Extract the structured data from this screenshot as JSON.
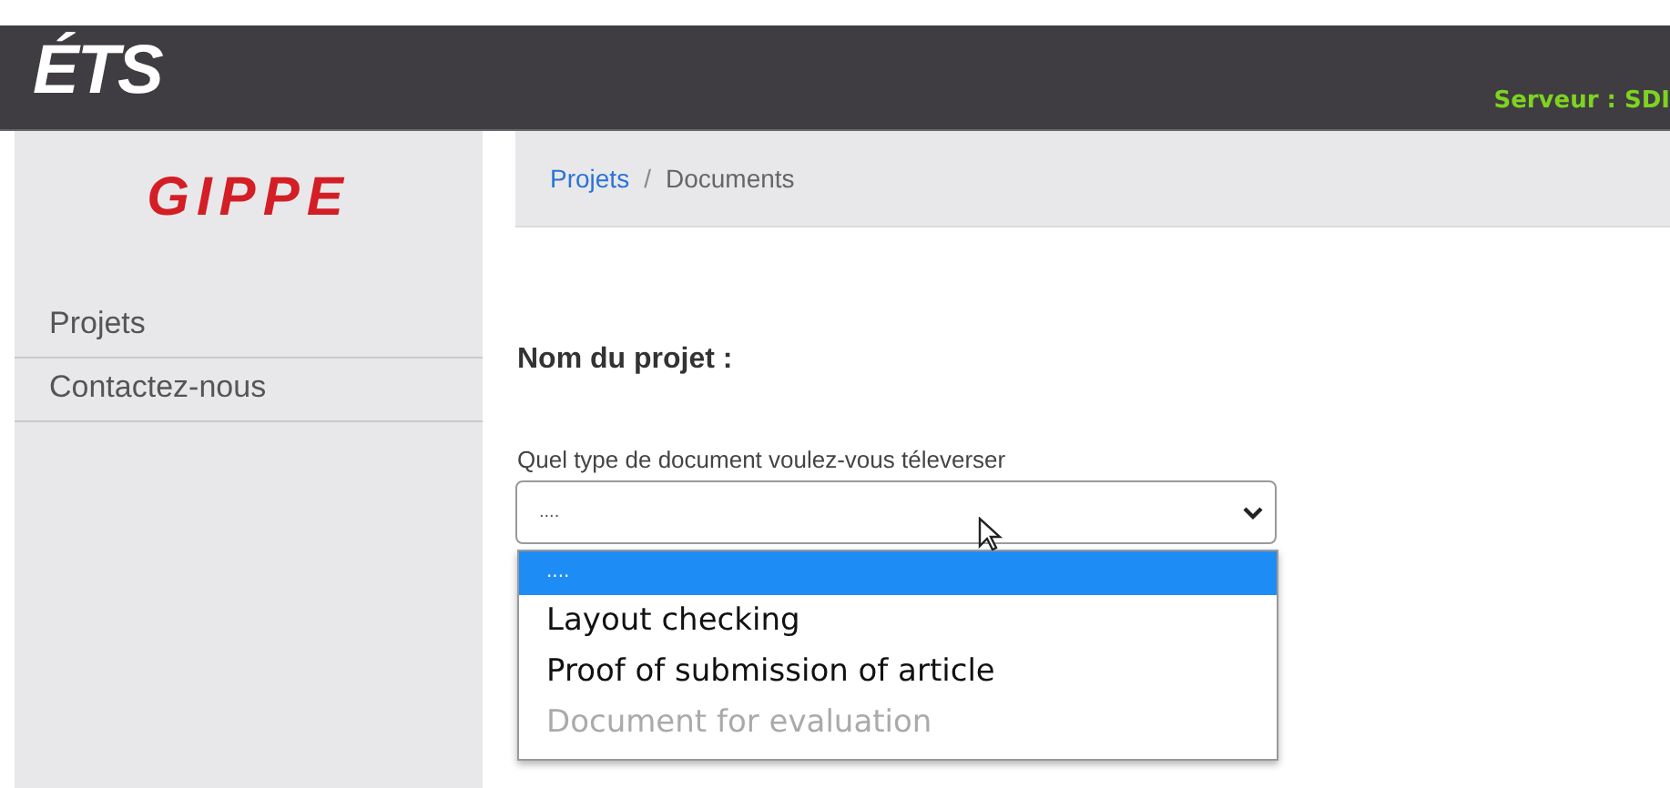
{
  "header": {
    "logo": "ÉTS",
    "server": "Serveur : SDI"
  },
  "sidebar": {
    "logo": "GIPPE",
    "items": [
      {
        "label": "Projets"
      },
      {
        "label": "Contactez-nous"
      }
    ]
  },
  "breadcrumb": [
    {
      "label": "Projets",
      "kind": "link"
    },
    {
      "label": "/",
      "kind": "separator"
    },
    {
      "label": "Documents",
      "kind": "current"
    }
  ],
  "form": {
    "project_label": "Nom du projet :",
    "select_label": "Quel type de document voulez-vous téleverser",
    "select_value": "....",
    "options": [
      {
        "label": "....",
        "selected": true,
        "disabled": false
      },
      {
        "label": "Layout checking",
        "selected": false,
        "disabled": false
      },
      {
        "label": "Proof of submission of article",
        "selected": false,
        "disabled": false
      },
      {
        "label": "Document for evaluation",
        "selected": false,
        "disabled": true
      }
    ]
  }
}
